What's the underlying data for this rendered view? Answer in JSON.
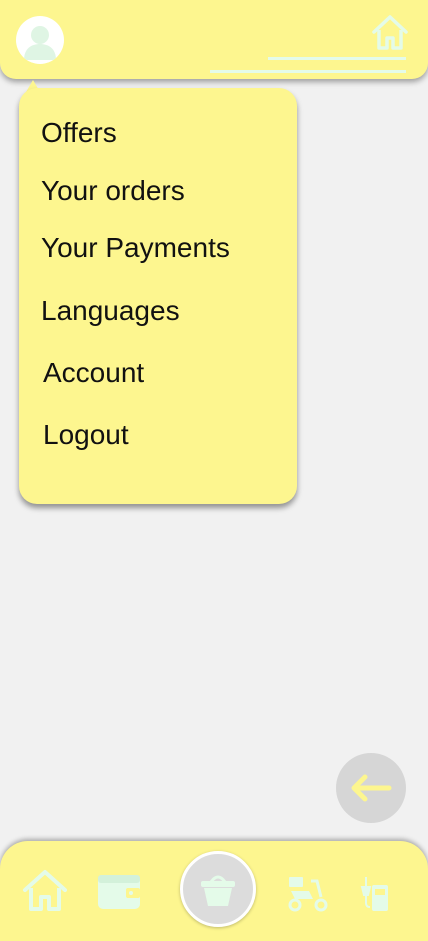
{
  "header": {
    "avatar_icon": "user-avatar-icon",
    "home_icon": "home-icon"
  },
  "menu": {
    "items": [
      {
        "label": "Offers"
      },
      {
        "label": "Your orders"
      },
      {
        "label": "Your Payments"
      },
      {
        "label": "Languages"
      },
      {
        "label": "Account"
      },
      {
        "label": "Logout"
      }
    ]
  },
  "back_button": {
    "icon": "arrow-left-icon"
  },
  "bottom_nav": {
    "items": [
      {
        "icon": "home-icon"
      },
      {
        "icon": "wallet-icon"
      },
      {
        "icon": "basket-icon"
      },
      {
        "icon": "scooter-icon"
      },
      {
        "icon": "fuel-pump-icon"
      }
    ]
  },
  "colors": {
    "accent": "#fdf68f",
    "icon_mint": "#e4fbe9",
    "background": "#f1f1f1",
    "back_button": "#d6d6d6"
  }
}
